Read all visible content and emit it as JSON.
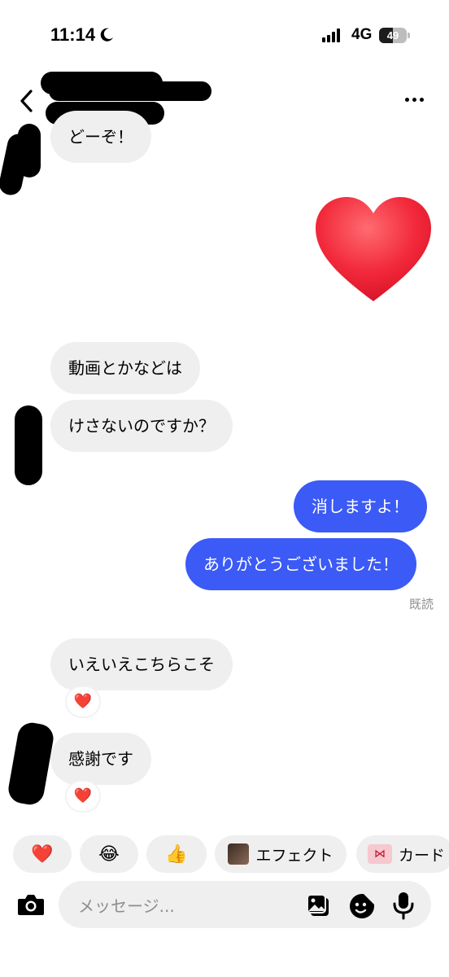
{
  "status_bar": {
    "time": "11:14",
    "network": "4G",
    "battery_level": "49",
    "battery_fraction": 0.49
  },
  "header": {
    "back_icon": "chevron-left-icon",
    "more_icon": "more-horizontal-icon"
  },
  "messages": [
    {
      "side": "in",
      "text": "どーぞ！"
    },
    {
      "side": "out",
      "type": "emoji",
      "icon": "heart-icon"
    },
    {
      "side": "in",
      "text": "動画とかなどは"
    },
    {
      "side": "in",
      "text": "けさないのですか？"
    },
    {
      "side": "out",
      "text": "消しますよ！"
    },
    {
      "side": "out",
      "text": "ありがとうございました！"
    },
    {
      "side": "in",
      "text": "いえいえこちらこそ",
      "reaction": "❤️"
    },
    {
      "side": "in",
      "text": "感謝です",
      "reaction": "❤️"
    }
  ],
  "read_receipt": "既読",
  "quick_replies": [
    {
      "emoji": "❤️"
    },
    {
      "emoji": "😂"
    },
    {
      "emoji": "👍"
    },
    {
      "label": "エフェクト"
    },
    {
      "label": "カード"
    }
  ],
  "composer": {
    "placeholder": "メッセージ...",
    "camera_icon": "camera-icon",
    "gallery_icon": "gallery-icon",
    "sticker_icon": "sticker-icon",
    "mic_icon": "microphone-icon"
  },
  "colors": {
    "outgoing_bubble": "#3b5af6",
    "incoming_bubble": "#efefef",
    "heart": "#f2293a"
  }
}
